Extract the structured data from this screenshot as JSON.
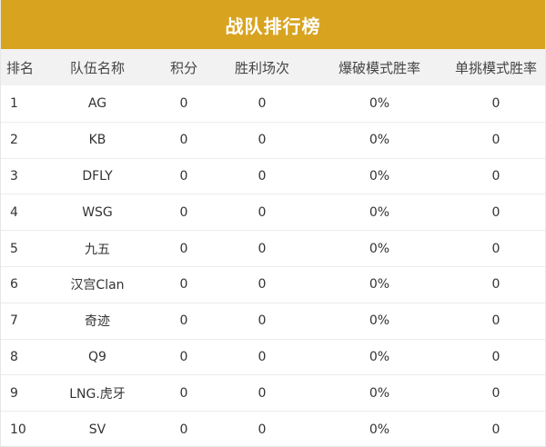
{
  "title": "战队排行榜",
  "columns": {
    "rank": "排名",
    "team": "队伍名称",
    "score": "积分",
    "wins": "胜利场次",
    "bomb_rate": "爆破模式胜率",
    "solo_rate": "单挑模式胜率"
  },
  "rows": [
    {
      "rank": "1",
      "team": "AG",
      "score": "0",
      "wins": "0",
      "bomb_rate": "0%",
      "solo_rate": "0"
    },
    {
      "rank": "2",
      "team": "KB",
      "score": "0",
      "wins": "0",
      "bomb_rate": "0%",
      "solo_rate": "0"
    },
    {
      "rank": "3",
      "team": "DFLY",
      "score": "0",
      "wins": "0",
      "bomb_rate": "0%",
      "solo_rate": "0"
    },
    {
      "rank": "4",
      "team": "WSG",
      "score": "0",
      "wins": "0",
      "bomb_rate": "0%",
      "solo_rate": "0"
    },
    {
      "rank": "5",
      "team": "九五",
      "score": "0",
      "wins": "0",
      "bomb_rate": "0%",
      "solo_rate": "0"
    },
    {
      "rank": "6",
      "team": "汉宫Clan",
      "score": "0",
      "wins": "0",
      "bomb_rate": "0%",
      "solo_rate": "0"
    },
    {
      "rank": "7",
      "team": "奇迹",
      "score": "0",
      "wins": "0",
      "bomb_rate": "0%",
      "solo_rate": "0"
    },
    {
      "rank": "8",
      "team": "Q9",
      "score": "0",
      "wins": "0",
      "bomb_rate": "0%",
      "solo_rate": "0"
    },
    {
      "rank": "9",
      "team": "LNG.虎牙",
      "score": "0",
      "wins": "0",
      "bomb_rate": "0%",
      "solo_rate": "0"
    },
    {
      "rank": "10",
      "team": "SV",
      "score": "0",
      "wins": "0",
      "bomb_rate": "0%",
      "solo_rate": "0"
    }
  ],
  "colors": {
    "title_bar": "#d8a31f",
    "header_bg": "#f2f2f2",
    "row_divider": "#ececec"
  }
}
